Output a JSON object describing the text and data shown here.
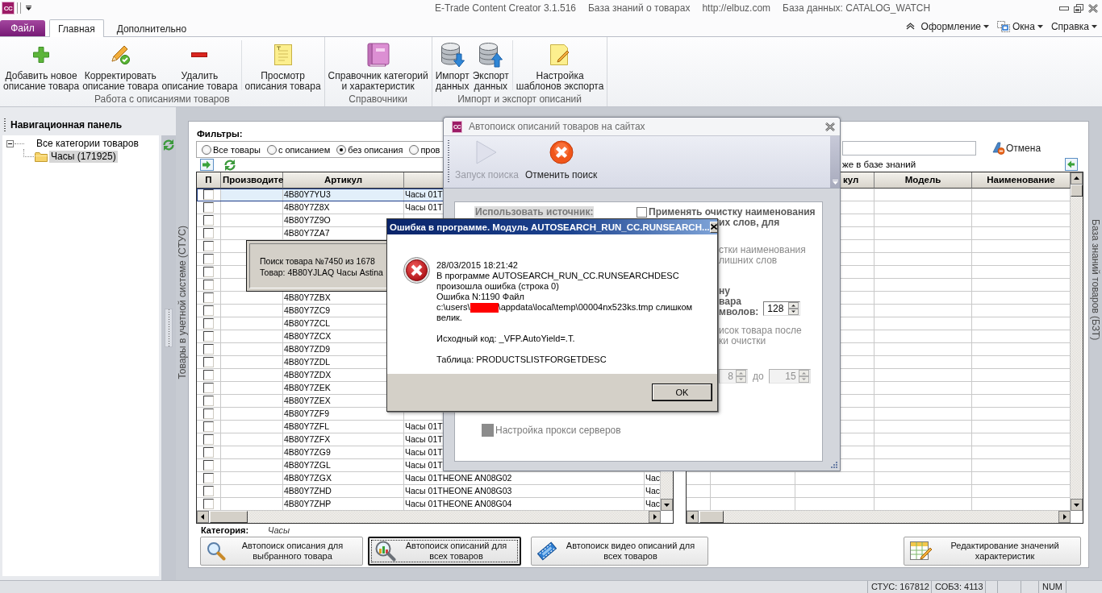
{
  "title_bar": {
    "logo": "CC",
    "texts": [
      "E-Trade Content Creator 3.1.516",
      "База знаний о товарах",
      "http://elbuz.com",
      "База данных: CATALOG_WATCH"
    ]
  },
  "ribbon": {
    "file_button": "Файл",
    "tabs": [
      {
        "label": "Главная",
        "selected": true
      },
      {
        "label": "Дополнительно",
        "selected": false
      }
    ],
    "menus": [
      {
        "label": "Оформление",
        "kind": "menu"
      },
      {
        "label": "Окна",
        "kind": "windows"
      },
      {
        "label": "Справка",
        "kind": "menu"
      }
    ],
    "groups": [
      {
        "label": "Работа с описаниями товаров",
        "buttons": [
          {
            "label": "Добавить новое\nописание товара",
            "kind": "add"
          },
          {
            "label": "Корректировать\nописание товара",
            "kind": "edit"
          },
          {
            "label": "Удалить\nописание товара",
            "kind": "delete"
          },
          {
            "label": "Просмотр\nописания товара",
            "kind": "view",
            "separator_before": true
          }
        ]
      },
      {
        "label": "Справочники",
        "buttons": [
          {
            "label": "Справочник категорий\nи характеристик",
            "kind": "reference"
          }
        ]
      },
      {
        "label": "Импорт и экспорт описаний",
        "buttons": [
          {
            "label": "Импорт\nданных",
            "kind": "import"
          },
          {
            "label": "Экспорт\nданных",
            "kind": "export"
          },
          {
            "label": "Настройка\nшаблонов экспорта",
            "kind": "template",
            "separator_before": true
          }
        ]
      }
    ]
  },
  "nav_panel": {
    "title": "Навигационная панель",
    "tree": [
      {
        "label": "Все категории товаров",
        "expanded": true,
        "selected": false,
        "children": [
          {
            "label": "Часы (171925)",
            "selected": true
          }
        ]
      }
    ]
  },
  "left_panel": {
    "side_label": "Товары в учетной системе (СТУС)",
    "filters_label": "Фильтры:",
    "filters": [
      {
        "label": "Все товары",
        "selected": false
      },
      {
        "label": "с описанием",
        "selected": false
      },
      {
        "label": "без описания",
        "selected": true
      },
      {
        "label": "пров",
        "selected": false
      }
    ],
    "table": {
      "columns": [
        "П",
        "Производите",
        "Артикул"
      ],
      "rows": [
        {
          "checked": false,
          "selected": true,
          "article": "4B80Y7YU3",
          "column_4": "Часы 01T"
        },
        {
          "checked": false,
          "selected": false,
          "article": "4B80Y7Z8X",
          "column_4": "Часы 01T"
        },
        {
          "checked": false,
          "selected": false,
          "article": "4B80Y7Z9O"
        },
        {
          "checked": false,
          "selected": false,
          "article": "4B80Y7ZA7"
        },
        {
          "checked": false,
          "selected": false
        },
        {
          "checked": false,
          "selected": false
        },
        {
          "checked": false,
          "selected": false
        },
        {
          "checked": false,
          "selected": false
        },
        {
          "checked": false,
          "selected": false,
          "article": "4B80Y7ZBX"
        },
        {
          "checked": false,
          "selected": false,
          "article": "4B80Y7ZC9"
        },
        {
          "checked": false,
          "selected": false,
          "article": "4B80Y7ZCL"
        },
        {
          "checked": false,
          "selected": false,
          "article": "4B80Y7ZCX"
        },
        {
          "checked": false,
          "selected": false,
          "article": "4B80Y7ZD9"
        },
        {
          "checked": false,
          "selected": false,
          "article": "4B80Y7ZDL"
        },
        {
          "checked": false,
          "selected": false,
          "article": "4B80Y7ZDX"
        },
        {
          "checked": false,
          "selected": false,
          "article": "4B80Y7ZEK"
        },
        {
          "checked": false,
          "selected": false,
          "article": "4B80Y7ZEX"
        },
        {
          "checked": false,
          "selected": false,
          "article": "4B80Y7ZF9"
        },
        {
          "checked": false,
          "selected": false,
          "article": "4B80Y7ZFL",
          "column_4": "Часы 01T"
        },
        {
          "checked": false,
          "selected": false,
          "article": "4B80Y7ZFX",
          "column_4": "Часы 01T"
        },
        {
          "checked": false,
          "selected": false,
          "article": "4B80Y7ZG9",
          "column_4": "Часы 01T"
        },
        {
          "checked": false,
          "selected": false,
          "article": "4B80Y7ZGL",
          "column_4": "Часы 01T"
        },
        {
          "checked": false,
          "selected": false,
          "article": "4B80Y7ZGX",
          "column_4": "Часы 01THEONE AN08G02",
          "column_5": "Час"
        },
        {
          "checked": false,
          "selected": false,
          "article": "4B80Y7ZHD",
          "column_4": "Часы 01THEONE AN08G03",
          "column_5": "Час"
        },
        {
          "checked": false,
          "selected": false,
          "article": "4B80Y7ZHP",
          "column_4": "Часы 01THEONE AN08G04",
          "column_5": "Час"
        }
      ]
    }
  },
  "right_panel": {
    "side_label": "База знаний товаров (БЗТ)",
    "cancel_button": "Отмена",
    "option_text": "же в базе знаний",
    "table": {
      "columns": [
        "кул",
        "Модель",
        "Наименование"
      ]
    }
  },
  "bottom_bar": {
    "category_label": "Категория:",
    "category_value": "Часы",
    "buttons": [
      {
        "label": "Автопоиск описания для\nвыбранного товара",
        "kind": "search_one",
        "focused": false
      },
      {
        "label": "Автопоиск описаний для\nвсех товаров",
        "kind": "search_all",
        "focused": true
      },
      {
        "label": "Автопоиск видео описаний для\nвсех товаров",
        "kind": "video",
        "focused": false
      },
      {
        "label": "Редактирование значений\nхарактеристик",
        "kind": "edit_values",
        "focused": false
      }
    ]
  },
  "status_bar": {
    "panes": [
      "СТУС: 167812",
      "СОБЗ: 4113",
      "NUM"
    ]
  },
  "progress_popup": {
    "lines": [
      "Поиск товара №7450 из 1678",
      "Товар: 4B80YJLAQ Часы Astina"
    ]
  },
  "search_dialog": {
    "logo": "CC",
    "title": "Автопоиск описаний товаров на сайтах",
    "toolbar": [
      {
        "label": "Запуск поиска",
        "kind": "start",
        "disabled": true
      },
      {
        "label": "Отменить поиск",
        "kind": "cancel",
        "disabled": false
      }
    ],
    "source_label": "Использовать источник:",
    "cleanup_option": {
      "label": "Применять очистку наименования",
      "label_rest": "их слов, для",
      "checked": false
    },
    "cleanup_hint": "стки наименования\nлишних слов",
    "length_label": "ну\nвара\nмволов:",
    "length_value": "128",
    "list_hint": "исок товара после\nки очистки",
    "range": {
      "from": "8",
      "to_label": "до",
      "to": "15",
      "disabled": true
    },
    "proxy_option": {
      "label": "Настройка прокси серверов",
      "disabled": true
    }
  },
  "error_dialog": {
    "title": "Ошибка в программе. Модуль AUTOSEARCH_RUN_CC.RUNSEARCH...",
    "paragraphs": [
      [
        {
          "kind": "text",
          "text": "28/03/2015 18:21:42"
        },
        {
          "kind": "text",
          "text": "В программе AUTOSEARCH_RUN_CC.RUNSEARCHDESC"
        },
        {
          "kind": "text",
          "text": "произошла ошибка (строка 0)"
        },
        {
          "kind": "text",
          "text": "Ошибка N:1190 Файл"
        },
        {
          "kind": "redacted",
          "before": "c:\\users\\",
          "after": "\\appdata\\local\\temp\\00004nx523ks.tmp слишком"
        },
        {
          "kind": "text",
          "text": "велик."
        }
      ],
      [
        {
          "kind": "text",
          "text": "Исходный код: _VFP.AutoYield=.T."
        }
      ],
      [
        {
          "kind": "text",
          "text": "Таблица: PRODUCTSLISTFORGETDESC"
        }
      ]
    ],
    "ok_button": "OK"
  }
}
